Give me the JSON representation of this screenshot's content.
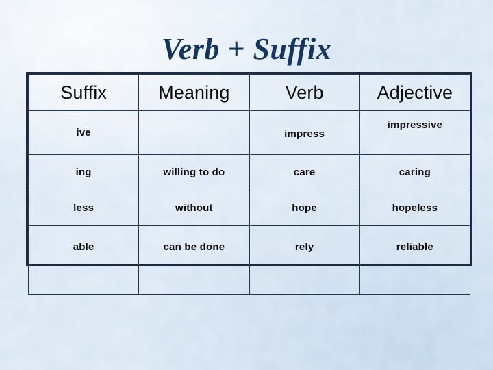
{
  "slide": {
    "title": "Verb + Suffix",
    "background_color": "#dfeaf6",
    "title_color": "#14365f",
    "border_color": "#1b2a3e",
    "text_color": "#0b0b0b"
  },
  "table": {
    "columns": [
      "Suffix",
      "Meaning",
      "Verb",
      "Adjective"
    ],
    "rows": [
      {
        "suffix": "ive",
        "meaning": "",
        "verb": "impress",
        "adjective": "impressive"
      },
      {
        "suffix": "ing",
        "meaning": "willing to do",
        "verb": "care",
        "adjective": "caring"
      },
      {
        "suffix": "less",
        "meaning": "without",
        "verb": "hope",
        "adjective": "hopeless"
      },
      {
        "suffix": "able",
        "meaning": "can be done",
        "verb": "rely",
        "adjective": "reliable"
      }
    ]
  }
}
